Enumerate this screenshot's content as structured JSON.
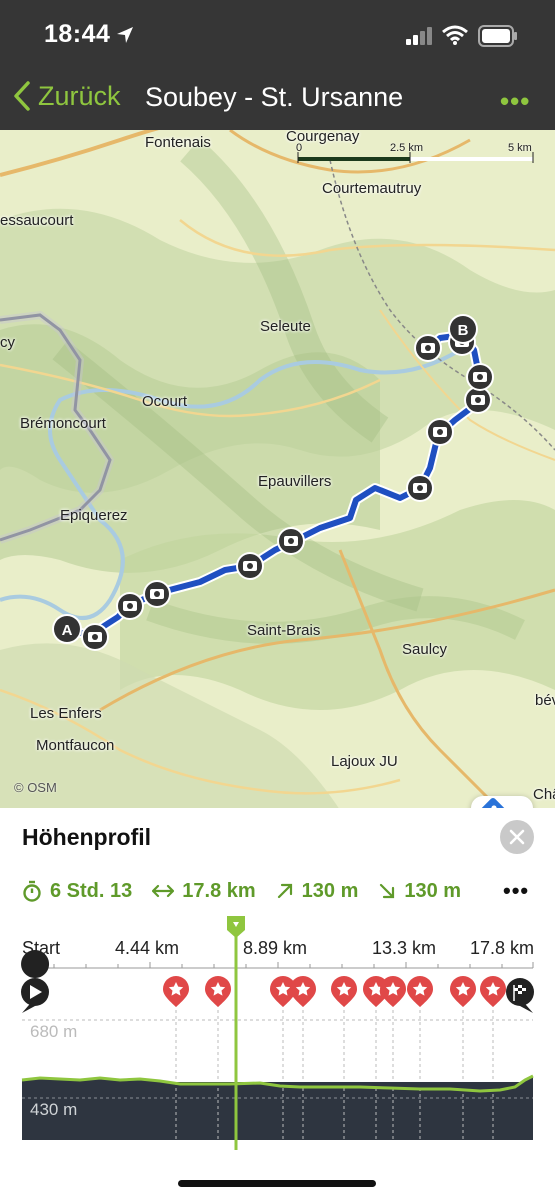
{
  "status_bar": {
    "time": "18:44"
  },
  "nav": {
    "back_label": "Zurück",
    "title": "Soubey - St. Ursanne",
    "more": "•••"
  },
  "map": {
    "places": [
      {
        "name": "Fontenais"
      },
      {
        "name": "Courgenay"
      },
      {
        "name": "Courtemautruy"
      },
      {
        "name": "essaucourt"
      },
      {
        "name": "Seleute"
      },
      {
        "name": "cy"
      },
      {
        "name": "Ocourt"
      },
      {
        "name": "Brémoncourt"
      },
      {
        "name": "Epauvillers"
      },
      {
        "name": "Epiquerez"
      },
      {
        "name": "Saint-Brais"
      },
      {
        "name": "Saulcy"
      },
      {
        "name": "Les Enfers"
      },
      {
        "name": "Montfaucon"
      },
      {
        "name": "Lajoux JU"
      },
      {
        "name": "bév"
      },
      {
        "name": "Châ"
      }
    ],
    "scale_labels": [
      "0",
      "2.5 km",
      "5 km"
    ],
    "start_marker": "A",
    "end_marker": "B",
    "attribution": "© OSM",
    "route_color": "#1f4fc1"
  },
  "profile": {
    "title": "Höhenprofil",
    "stats": {
      "duration": "6 Std. 13",
      "distance": "17.8 km",
      "ascent": "130 m",
      "descent": "130 m"
    },
    "more": "•••",
    "x_labels": [
      "Start",
      "4.44 km",
      "8.89 km",
      "13.3 km",
      "17.8 km"
    ],
    "y_labels": [
      "680 m",
      "430 m"
    ],
    "accent_color": "#8fc63f"
  }
}
